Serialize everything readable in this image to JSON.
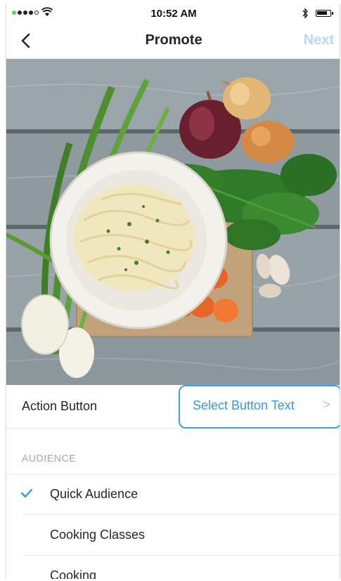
{
  "status_bar": {
    "time": "10:52 AM"
  },
  "nav": {
    "title": "Promote",
    "next_label": "Next"
  },
  "action_button": {
    "label": "Action Button",
    "select_text": "Select Button Text",
    "chevron": ">"
  },
  "audience": {
    "header": "AUDIENCE",
    "items": [
      {
        "label": "Quick Audience",
        "selected": true
      },
      {
        "label": "Cooking Classes",
        "selected": false
      },
      {
        "label": "Cooking",
        "selected": false
      }
    ]
  },
  "colors": {
    "accent_blue": "#3897f0",
    "highlight_border": "#3aa3e3",
    "next_disabled": "#b9d9f5"
  }
}
